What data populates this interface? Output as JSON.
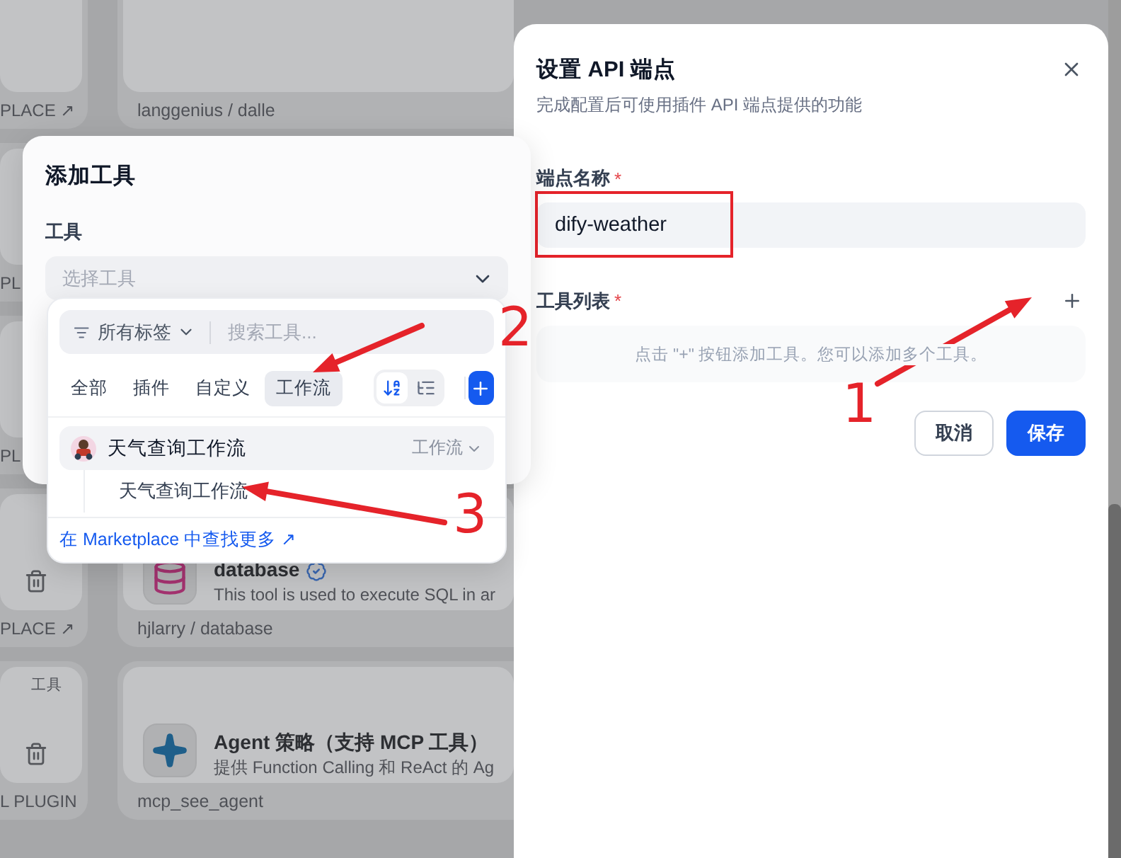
{
  "plugin_cards": [
    {
      "left": {
        "footer": "PLACE ↗"
      },
      "right": {
        "footer": "langgenius / dalle"
      }
    },
    {
      "left": {
        "footer": "PL"
      }
    },
    {
      "left": {
        "footer": "PL"
      }
    },
    {
      "left": {
        "footer": "PLACE ↗",
        "deletable": true
      },
      "right": {
        "kind": "database",
        "title": "database",
        "description": "This tool is used to execute SQL in ar",
        "footer": "hjlarry / database"
      }
    },
    {
      "left": {
        "tag": "工具",
        "footer": "L PLUGIN",
        "deletable": true
      },
      "right": {
        "kind": "agent",
        "title": "Agent 策略（支持 MCP 工具）",
        "description": "提供 Function Calling 和 ReAct 的 Ag",
        "footer": "mcp_see_agent"
      }
    }
  ],
  "endpoint_panel": {
    "title": "设置 API 端点",
    "subtitle": "完成配置后可使用插件 API 端点提供的功能",
    "name_label": "端点名称",
    "name_mark": "*",
    "name_value": "dify-weather",
    "name_highlighted": true,
    "tools_label": "工具列表",
    "tools_mark": "*",
    "tools_empty_text": "点击 \"+\" 按钮添加工具。您可以添加多个工具。",
    "buttons": [
      {
        "label": "取消",
        "kind": "secondary"
      },
      {
        "label": "保存",
        "kind": "primary"
      }
    ]
  },
  "add_tool_dialog": {
    "title": "添加工具",
    "tool_label": "工具",
    "select_placeholder": "选择工具",
    "picker": {
      "tag_filter": "所有标签",
      "search_placeholder": "搜索工具...",
      "tabs": [
        {
          "label": "全部",
          "selected": false
        },
        {
          "label": "插件",
          "selected": false
        },
        {
          "label": "自定义",
          "selected": false
        },
        {
          "label": "工作流",
          "selected": true
        }
      ],
      "view_modes": [
        {
          "kind": "alphabetical",
          "selected": true
        },
        {
          "kind": "tree",
          "selected": false
        }
      ],
      "groups": [
        {
          "name": "天气查询工作流",
          "type": "工作流",
          "expanded": true,
          "children": [
            {
              "name": "天气查询工作流"
            }
          ]
        }
      ],
      "marketplace_link": "在 Marketplace 中查找更多 ↗"
    }
  },
  "annotations": [
    {
      "kind": "arrow",
      "label": "1"
    },
    {
      "kind": "arrow",
      "label": "2"
    },
    {
      "kind": "arrow",
      "label": "3"
    }
  ]
}
